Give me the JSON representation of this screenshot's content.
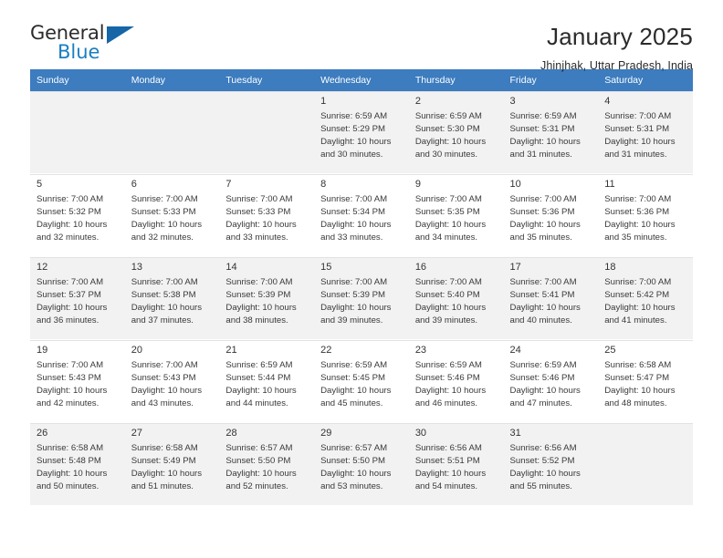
{
  "brand": {
    "name_top": "General",
    "name_bottom": "Blue",
    "triangle_color": "#1666a8",
    "blue_color": "#1a7fc1"
  },
  "header": {
    "title": "January 2025",
    "subtitle": "Jhinjhak, Uttar Pradesh, India"
  },
  "theme": {
    "header_row_bg": "#3c7cbf",
    "header_row_text": "#ffffff",
    "shaded_cell_bg": "#f2f2f2",
    "plain_cell_bg": "#ffffff",
    "grid_line": "#e2e2e2"
  },
  "calendar": {
    "weekday_headers": [
      "Sunday",
      "Monday",
      "Tuesday",
      "Wednesday",
      "Thursday",
      "Friday",
      "Saturday"
    ],
    "weeks": [
      [
        {
          "day": "",
          "sunrise": "",
          "sunset": "",
          "daylight_line1": "",
          "daylight_line2": ""
        },
        {
          "day": "",
          "sunrise": "",
          "sunset": "",
          "daylight_line1": "",
          "daylight_line2": ""
        },
        {
          "day": "",
          "sunrise": "",
          "sunset": "",
          "daylight_line1": "",
          "daylight_line2": ""
        },
        {
          "day": "1",
          "sunrise": "Sunrise: 6:59 AM",
          "sunset": "Sunset: 5:29 PM",
          "daylight_line1": "Daylight: 10 hours",
          "daylight_line2": "and 30 minutes."
        },
        {
          "day": "2",
          "sunrise": "Sunrise: 6:59 AM",
          "sunset": "Sunset: 5:30 PM",
          "daylight_line1": "Daylight: 10 hours",
          "daylight_line2": "and 30 minutes."
        },
        {
          "day": "3",
          "sunrise": "Sunrise: 6:59 AM",
          "sunset": "Sunset: 5:31 PM",
          "daylight_line1": "Daylight: 10 hours",
          "daylight_line2": "and 31 minutes."
        },
        {
          "day": "4",
          "sunrise": "Sunrise: 7:00 AM",
          "sunset": "Sunset: 5:31 PM",
          "daylight_line1": "Daylight: 10 hours",
          "daylight_line2": "and 31 minutes."
        }
      ],
      [
        {
          "day": "5",
          "sunrise": "Sunrise: 7:00 AM",
          "sunset": "Sunset: 5:32 PM",
          "daylight_line1": "Daylight: 10 hours",
          "daylight_line2": "and 32 minutes."
        },
        {
          "day": "6",
          "sunrise": "Sunrise: 7:00 AM",
          "sunset": "Sunset: 5:33 PM",
          "daylight_line1": "Daylight: 10 hours",
          "daylight_line2": "and 32 minutes."
        },
        {
          "day": "7",
          "sunrise": "Sunrise: 7:00 AM",
          "sunset": "Sunset: 5:33 PM",
          "daylight_line1": "Daylight: 10 hours",
          "daylight_line2": "and 33 minutes."
        },
        {
          "day": "8",
          "sunrise": "Sunrise: 7:00 AM",
          "sunset": "Sunset: 5:34 PM",
          "daylight_line1": "Daylight: 10 hours",
          "daylight_line2": "and 33 minutes."
        },
        {
          "day": "9",
          "sunrise": "Sunrise: 7:00 AM",
          "sunset": "Sunset: 5:35 PM",
          "daylight_line1": "Daylight: 10 hours",
          "daylight_line2": "and 34 minutes."
        },
        {
          "day": "10",
          "sunrise": "Sunrise: 7:00 AM",
          "sunset": "Sunset: 5:36 PM",
          "daylight_line1": "Daylight: 10 hours",
          "daylight_line2": "and 35 minutes."
        },
        {
          "day": "11",
          "sunrise": "Sunrise: 7:00 AM",
          "sunset": "Sunset: 5:36 PM",
          "daylight_line1": "Daylight: 10 hours",
          "daylight_line2": "and 35 minutes."
        }
      ],
      [
        {
          "day": "12",
          "sunrise": "Sunrise: 7:00 AM",
          "sunset": "Sunset: 5:37 PM",
          "daylight_line1": "Daylight: 10 hours",
          "daylight_line2": "and 36 minutes."
        },
        {
          "day": "13",
          "sunrise": "Sunrise: 7:00 AM",
          "sunset": "Sunset: 5:38 PM",
          "daylight_line1": "Daylight: 10 hours",
          "daylight_line2": "and 37 minutes."
        },
        {
          "day": "14",
          "sunrise": "Sunrise: 7:00 AM",
          "sunset": "Sunset: 5:39 PM",
          "daylight_line1": "Daylight: 10 hours",
          "daylight_line2": "and 38 minutes."
        },
        {
          "day": "15",
          "sunrise": "Sunrise: 7:00 AM",
          "sunset": "Sunset: 5:39 PM",
          "daylight_line1": "Daylight: 10 hours",
          "daylight_line2": "and 39 minutes."
        },
        {
          "day": "16",
          "sunrise": "Sunrise: 7:00 AM",
          "sunset": "Sunset: 5:40 PM",
          "daylight_line1": "Daylight: 10 hours",
          "daylight_line2": "and 39 minutes."
        },
        {
          "day": "17",
          "sunrise": "Sunrise: 7:00 AM",
          "sunset": "Sunset: 5:41 PM",
          "daylight_line1": "Daylight: 10 hours",
          "daylight_line2": "and 40 minutes."
        },
        {
          "day": "18",
          "sunrise": "Sunrise: 7:00 AM",
          "sunset": "Sunset: 5:42 PM",
          "daylight_line1": "Daylight: 10 hours",
          "daylight_line2": "and 41 minutes."
        }
      ],
      [
        {
          "day": "19",
          "sunrise": "Sunrise: 7:00 AM",
          "sunset": "Sunset: 5:43 PM",
          "daylight_line1": "Daylight: 10 hours",
          "daylight_line2": "and 42 minutes."
        },
        {
          "day": "20",
          "sunrise": "Sunrise: 7:00 AM",
          "sunset": "Sunset: 5:43 PM",
          "daylight_line1": "Daylight: 10 hours",
          "daylight_line2": "and 43 minutes."
        },
        {
          "day": "21",
          "sunrise": "Sunrise: 6:59 AM",
          "sunset": "Sunset: 5:44 PM",
          "daylight_line1": "Daylight: 10 hours",
          "daylight_line2": "and 44 minutes."
        },
        {
          "day": "22",
          "sunrise": "Sunrise: 6:59 AM",
          "sunset": "Sunset: 5:45 PM",
          "daylight_line1": "Daylight: 10 hours",
          "daylight_line2": "and 45 minutes."
        },
        {
          "day": "23",
          "sunrise": "Sunrise: 6:59 AM",
          "sunset": "Sunset: 5:46 PM",
          "daylight_line1": "Daylight: 10 hours",
          "daylight_line2": "and 46 minutes."
        },
        {
          "day": "24",
          "sunrise": "Sunrise: 6:59 AM",
          "sunset": "Sunset: 5:46 PM",
          "daylight_line1": "Daylight: 10 hours",
          "daylight_line2": "and 47 minutes."
        },
        {
          "day": "25",
          "sunrise": "Sunrise: 6:58 AM",
          "sunset": "Sunset: 5:47 PM",
          "daylight_line1": "Daylight: 10 hours",
          "daylight_line2": "and 48 minutes."
        }
      ],
      [
        {
          "day": "26",
          "sunrise": "Sunrise: 6:58 AM",
          "sunset": "Sunset: 5:48 PM",
          "daylight_line1": "Daylight: 10 hours",
          "daylight_line2": "and 50 minutes."
        },
        {
          "day": "27",
          "sunrise": "Sunrise: 6:58 AM",
          "sunset": "Sunset: 5:49 PM",
          "daylight_line1": "Daylight: 10 hours",
          "daylight_line2": "and 51 minutes."
        },
        {
          "day": "28",
          "sunrise": "Sunrise: 6:57 AM",
          "sunset": "Sunset: 5:50 PM",
          "daylight_line1": "Daylight: 10 hours",
          "daylight_line2": "and 52 minutes."
        },
        {
          "day": "29",
          "sunrise": "Sunrise: 6:57 AM",
          "sunset": "Sunset: 5:50 PM",
          "daylight_line1": "Daylight: 10 hours",
          "daylight_line2": "and 53 minutes."
        },
        {
          "day": "30",
          "sunrise": "Sunrise: 6:56 AM",
          "sunset": "Sunset: 5:51 PM",
          "daylight_line1": "Daylight: 10 hours",
          "daylight_line2": "and 54 minutes."
        },
        {
          "day": "31",
          "sunrise": "Sunrise: 6:56 AM",
          "sunset": "Sunset: 5:52 PM",
          "daylight_line1": "Daylight: 10 hours",
          "daylight_line2": "and 55 minutes."
        },
        {
          "day": "",
          "sunrise": "",
          "sunset": "",
          "daylight_line1": "",
          "daylight_line2": ""
        }
      ]
    ]
  }
}
